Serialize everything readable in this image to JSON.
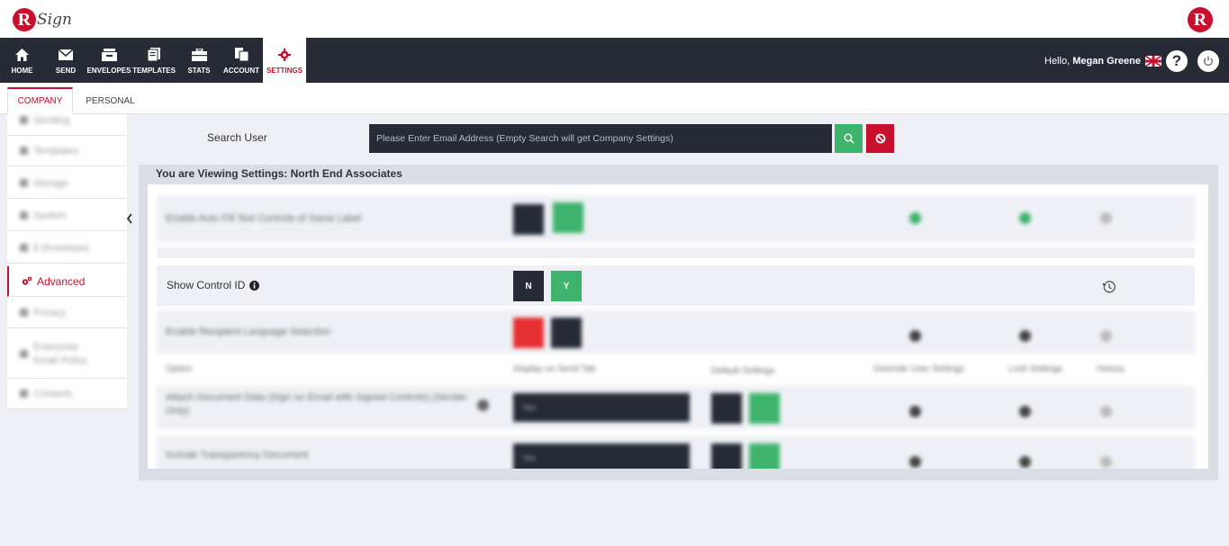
{
  "brand": {
    "logo_letter": "R",
    "logo_text": "Sign",
    "right_logo_letter": "R"
  },
  "nav": {
    "items": [
      {
        "label": "HOME",
        "icon": "home-icon"
      },
      {
        "label": "SEND",
        "icon": "envelope-icon"
      },
      {
        "label": "ENVELOPES",
        "icon": "inbox-icon"
      },
      {
        "label": "TEMPLATES",
        "icon": "templates-icon"
      },
      {
        "label": "STATS",
        "icon": "briefcase-icon"
      },
      {
        "label": "ACCOUNT",
        "icon": "account-icon"
      },
      {
        "label": "SETTINGS",
        "icon": "gear-icon",
        "active": true
      }
    ],
    "greeting": "Hello,",
    "user_name": "Megan Greene",
    "help_label": "?"
  },
  "tabs": [
    {
      "label": "COMPANY",
      "active": true
    },
    {
      "label": "PERSONAL",
      "active": false
    }
  ],
  "sidebar": {
    "items": [
      {
        "label": "Sending",
        "blurred": true
      },
      {
        "label": "Templates",
        "blurred": true
      },
      {
        "label": "Storage",
        "blurred": true
      },
      {
        "label": "System",
        "blurred": true
      },
      {
        "label": "E-Envelopes",
        "blurred": true
      },
      {
        "label": "Advanced",
        "active": true
      },
      {
        "label": "Privacy",
        "blurred": true
      },
      {
        "label": "Enterprise Email Policy",
        "blurred": true
      },
      {
        "label": "Contacts",
        "blurred": true
      }
    ]
  },
  "search": {
    "label": "Search User",
    "placeholder": "Please Enter Email Address (Empty Search will get Company Settings)"
  },
  "panel": {
    "title": "You are Viewing Settings: North End Associates",
    "show_control_id": {
      "label": "Show Control ID",
      "n_label": "N",
      "y_label": "Y"
    },
    "blurred_rows": {
      "row1": "Enable Auto Fill Text Controls of Same Label",
      "row3": "Enable Recipient Language Selection",
      "headers": [
        "Option",
        "Display on Send Tab",
        "Default Settings",
        "Override User Settings",
        "Lock Settings",
        "History"
      ],
      "row5": "Attach Document Data (Sign on Email with Signed Controls) (Sender Only)",
      "row6": "Include Transparency Document",
      "select_value": "Yes"
    }
  },
  "colors": {
    "nav_bg": "#262b36",
    "accent_red": "#c8102e",
    "accent_green": "#3db36b"
  }
}
